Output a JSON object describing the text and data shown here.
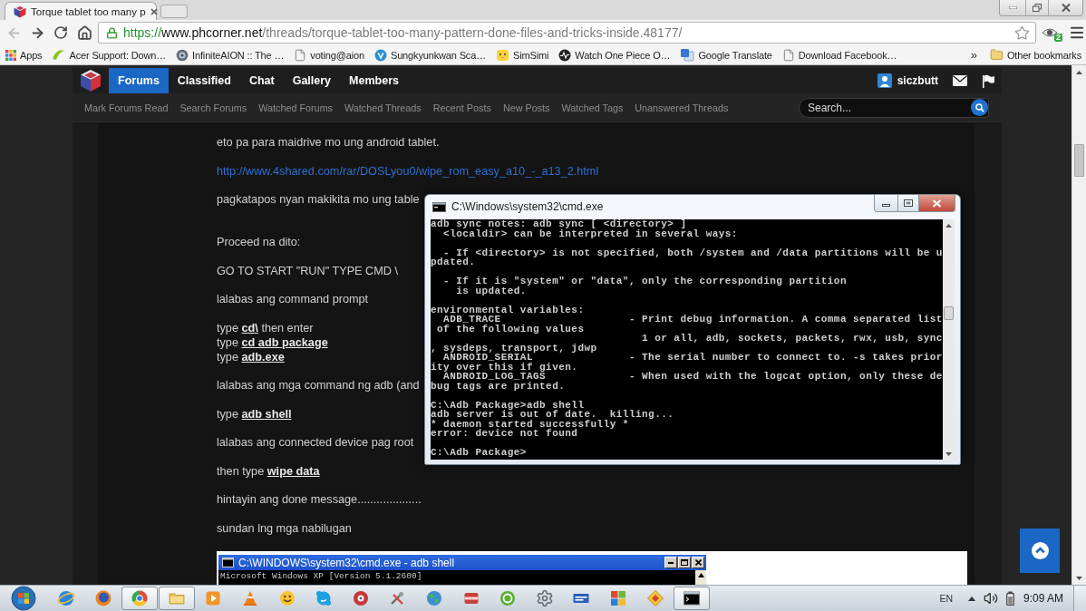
{
  "browser": {
    "tabs": [
      {
        "title": "Torque tablet too many p",
        "selected": true
      }
    ],
    "history": {
      "back_disabled": true
    },
    "address": {
      "scheme": "https://",
      "host": "www.phcorner.net",
      "path": "/threads/torque-tablet-too-many-pattern-done-files-and-tricks-inside.48177/"
    },
    "extension_badge": "2",
    "bookmarks": [
      {
        "label": "Apps",
        "kind": "grid"
      },
      {
        "label": "Acer Support: Down…",
        "kind": "swoosh"
      },
      {
        "label": "InfiniteAION :: The …",
        "kind": "emblem"
      },
      {
        "label": "voting@aion",
        "kind": "page"
      },
      {
        "label": "Sungkyunkwan Sca…",
        "kind": "badge"
      },
      {
        "label": "SimSimi",
        "kind": "chick"
      },
      {
        "label": "Watch One Piece O…",
        "kind": "pulse"
      },
      {
        "label": "Google Translate",
        "kind": "translate"
      },
      {
        "label": "Download Facebook…",
        "kind": "page"
      }
    ],
    "bookmarks_overflow": "»",
    "other_bookmarks": "Other bookmarks"
  },
  "site": {
    "nav": [
      {
        "label": "Forums",
        "selected": true
      },
      {
        "label": "Classified",
        "selected": false
      },
      {
        "label": "Chat",
        "selected": false
      },
      {
        "label": "Gallery",
        "selected": false
      },
      {
        "label": "Members",
        "selected": false
      }
    ],
    "user": "siczbutt",
    "subnav": [
      "Mark Forums Read",
      "Search Forums",
      "Watched Forums",
      "Watched Threads",
      "Recent Posts",
      "New Posts",
      "Watched Tags",
      "Unanswered Threads"
    ],
    "search": {
      "placeholder": "Search..."
    }
  },
  "post": {
    "blocks": [
      {
        "kind": "text",
        "text": "eto pa para maidrive mo ung android tablet."
      },
      {
        "kind": "link",
        "text": "http://www.4shared.com/rar/DOSLyou0/wipe_rom_easy_a10_-_a13_2.html"
      },
      {
        "kind": "text",
        "text": "pagkatapos nyan makikita mo ung table"
      },
      {
        "kind": "blank"
      },
      {
        "kind": "text",
        "text": "Proceed na dito:"
      },
      {
        "kind": "text",
        "text": "GO TO START \"RUN\" TYPE CMD \\"
      },
      {
        "kind": "text",
        "text": "lalabas ang command prompt"
      },
      {
        "kind": "steps",
        "lines": [
          {
            "lead": "type ",
            "command": "cd\\",
            "tail": " then enter"
          },
          {
            "lead": "type ",
            "command": "cd adb package"
          },
          {
            "lead": "type ",
            "command": "adb.exe"
          }
        ]
      },
      {
        "kind": "text",
        "text": "lalabas ang mga command ng adb (and"
      },
      {
        "kind": "steps",
        "lines": [
          {
            "lead": "type ",
            "command": "adb shell"
          }
        ]
      },
      {
        "kind": "text",
        "text": "lalabas ang connected device pag root"
      },
      {
        "kind": "steps",
        "lines": [
          {
            "lead": "then type ",
            "command": "wipe data"
          }
        ]
      },
      {
        "kind": "text",
        "text": "hintayin ang done message...................."
      },
      {
        "kind": "text",
        "text": "sundan lng mga nabilugan"
      }
    ]
  },
  "attached_image": {
    "window_title": "C:\\WINDOWS\\system32\\cmd.exe - adb shell",
    "lines": [
      "Microsoft Windows XP [Version 5.1.2600]"
    ]
  },
  "cmd_window": {
    "title": "C:\\Windows\\system32\\cmd.exe",
    "blocks": [
      [
        "adb sync notes: adb sync [ <directory> ]",
        "  <localdir> can be interpreted in several ways:"
      ],
      [
        "  - If <directory> is not specified, both /system and /data partitions will be u",
        "pdated."
      ],
      [
        "  - If it is \"system\" or \"data\", only the corresponding partition",
        "    is updated."
      ],
      [
        "environmental variables:",
        "  ADB_TRACE                    - Print debug information. A comma separated list",
        " of the following values",
        "                                 1 or all, adb, sockets, packets, rwx, usb, sync",
        ", sysdeps, transport, jdwp",
        "  ANDROID_SERIAL               - The serial number to connect to. -s takes prior",
        "ity over this if given.",
        "  ANDROID_LOG_TAGS             - When used with the logcat option, only these de",
        "bug tags are printed."
      ],
      [
        "C:\\Adb Package>adb shell",
        "adb server is out of date.  killing...",
        "* daemon started successfully *",
        "error: device not found"
      ],
      [
        "C:\\Adb Package>"
      ]
    ]
  },
  "taskbar": {
    "apps": [
      {
        "kind": "globe",
        "open": false
      },
      {
        "kind": "flame",
        "open": false
      },
      {
        "kind": "wheel",
        "open": true
      },
      {
        "kind": "folder",
        "open": true
      },
      {
        "kind": "player",
        "open": false
      },
      {
        "kind": "cone",
        "open": false
      },
      {
        "kind": "smiley",
        "open": false
      },
      {
        "kind": "bubble",
        "open": false
      },
      {
        "kind": "disc",
        "open": false
      },
      {
        "kind": "tool",
        "open": false
      },
      {
        "kind": "earth",
        "open": false
      },
      {
        "kind": "box",
        "open": false
      },
      {
        "kind": "ring",
        "open": false
      },
      {
        "kind": "gear",
        "open": false
      },
      {
        "kind": "banner",
        "open": false
      },
      {
        "kind": "tiles",
        "open": false
      },
      {
        "kind": "diamond",
        "open": false
      },
      {
        "kind": "console",
        "open": true
      }
    ],
    "language": "EN",
    "clock": "9:09 AM"
  }
}
